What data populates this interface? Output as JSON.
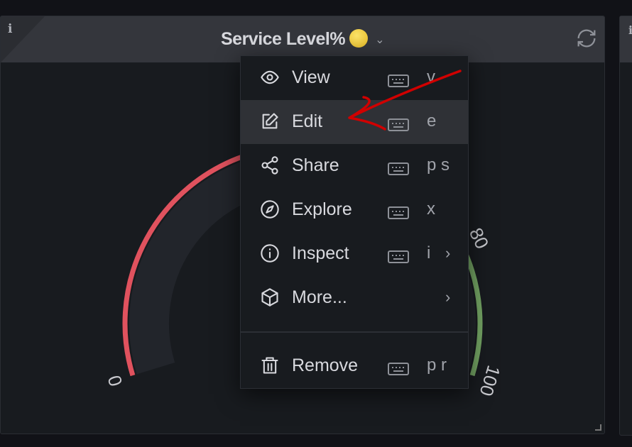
{
  "panel": {
    "title": "Service Level%",
    "status_icon": "yellow-circle-emoji",
    "info_icon": "info-icon",
    "refresh_icon": "refresh-icon",
    "gauge": {
      "min": 0,
      "max": 100,
      "thresholds": [
        {
          "from": 0,
          "to": 80,
          "color": "#e0525e"
        },
        {
          "from": 80,
          "to": 100,
          "color": "#73a363"
        }
      ],
      "tick_labels": [
        "0",
        "80",
        "100"
      ]
    }
  },
  "menu": {
    "items": [
      {
        "label": "View",
        "icon": "eye-icon",
        "shortcut": "v",
        "submenu": false
      },
      {
        "label": "Edit",
        "icon": "edit-icon",
        "shortcut": "e",
        "submenu": false,
        "highlighted": true
      },
      {
        "label": "Share",
        "icon": "share-icon",
        "shortcut": "p s",
        "submenu": false
      },
      {
        "label": "Explore",
        "icon": "compass-icon",
        "shortcut": "x",
        "submenu": false
      },
      {
        "label": "Inspect",
        "icon": "info-circle-icon",
        "shortcut": "i",
        "submenu": true
      },
      {
        "label": "More...",
        "icon": "cube-icon",
        "shortcut": "",
        "submenu": true
      },
      {
        "label": "Remove",
        "icon": "trash-icon",
        "shortcut": "p r",
        "submenu": false
      }
    ]
  },
  "annotation": {
    "type": "red-arrow",
    "color": "#d00000",
    "target": "Edit"
  },
  "colors": {
    "background": "#111217",
    "panel": "#181b1f",
    "header": "#34363c",
    "menu_highlight": "#2f3136"
  }
}
